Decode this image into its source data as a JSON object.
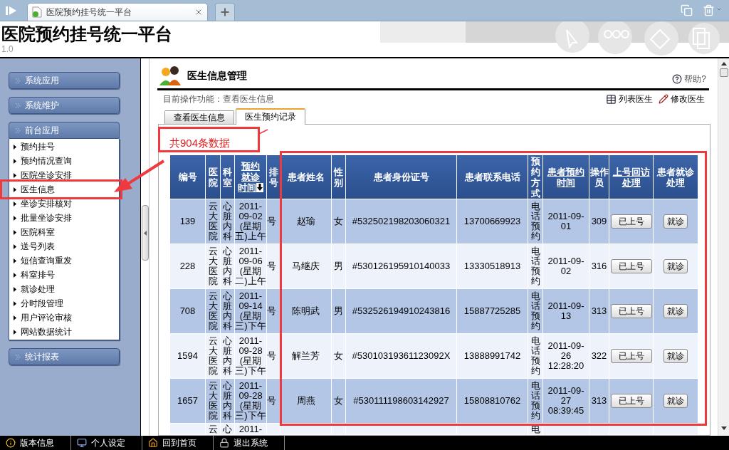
{
  "browser_tab": {
    "title": "医院预约挂号统一平台"
  },
  "header": {
    "title": "医院预约挂号统一平台",
    "version": "1.0"
  },
  "sidebar": {
    "groups": [
      {
        "label": "系统应用",
        "expanded": false
      },
      {
        "label": "系统维护",
        "expanded": false
      },
      {
        "label": "前台应用",
        "expanded": true,
        "items": [
          "预约挂号",
          "预约情况查询",
          "医院坐诊安排",
          "医生信息",
          "坐诊安排核对",
          "批量坐诊安排",
          "医院科室",
          "送号列表",
          "短信查询重发",
          "科室排号",
          "就诊处理",
          "分时段管理",
          "用户评论审核",
          "网站数据统计"
        ]
      },
      {
        "label": "统计报表",
        "expanded": false
      }
    ]
  },
  "panel": {
    "title": "医生信息管理",
    "help": "帮助?",
    "breadcrumb": "目前操作功能：查看医生信息",
    "actions": [
      {
        "label": "列表医生",
        "kind": "list"
      },
      {
        "label": "修改医生",
        "kind": "edit"
      }
    ]
  },
  "tabs": [
    {
      "label": "查看医生信息",
      "selected": false
    },
    {
      "label": "医生预约记录",
      "selected": true
    }
  ],
  "record_count": "共904条数据",
  "table": {
    "columns": [
      {
        "label": "编号",
        "link": false,
        "sorted": false
      },
      {
        "label": "医院",
        "link": false,
        "sorted": false
      },
      {
        "label": "科室",
        "link": false,
        "sorted": false
      },
      {
        "label": "预约就诊时间",
        "link": true,
        "sorted": true
      },
      {
        "label": "排号",
        "link": false,
        "sorted": false
      },
      {
        "label": "患者姓名",
        "link": false,
        "sorted": false
      },
      {
        "label": "性别",
        "link": false,
        "sorted": false
      },
      {
        "label": "患者身份证号",
        "link": false,
        "sorted": false
      },
      {
        "label": "患者联系电话",
        "link": false,
        "sorted": false
      },
      {
        "label": "预约方式",
        "link": false,
        "sorted": false
      },
      {
        "label": "患者预约时间",
        "link": true,
        "sorted": false
      },
      {
        "label": "操作员",
        "link": false,
        "sorted": false
      },
      {
        "label": "上号回访处理",
        "link": true,
        "sorted": false
      },
      {
        "label": "患者就诊处理",
        "link": false,
        "sorted": false
      }
    ],
    "rows": [
      {
        "id": "139",
        "hospital": "云大医院",
        "department": "心脏内科",
        "visit_time": "2011-\n09-02\n(星期五)上午",
        "slot": "号",
        "name": "赵瑜",
        "gender": "女",
        "id_card": "#532502198203060321",
        "phone": "13700669923",
        "method": "电话预约",
        "booked_at": "2011-09-\n01",
        "operator": "309",
        "callback_button": "已上号",
        "visit_button": "就诊"
      },
      {
        "id": "228",
        "hospital": "云大医院",
        "department": "心脏内科",
        "visit_time": "2011-\n09-06\n(星期二)上午",
        "slot": "号",
        "name": "马继庆",
        "gender": "男",
        "id_card": "#530126195910140033",
        "phone": "13330518913",
        "method": "电话预约",
        "booked_at": "2011-09-\n02",
        "operator": "316",
        "callback_button": "已上号",
        "visit_button": "就诊"
      },
      {
        "id": "708",
        "hospital": "云大医院",
        "department": "心脏内科",
        "visit_time": "2011-\n09-14\n(星期三)下午",
        "slot": "号",
        "name": "陈明武",
        "gender": "男",
        "id_card": "#532526194910243816",
        "phone": "15887725285",
        "method": "电话预约",
        "booked_at": "2011-09-\n13",
        "operator": "313",
        "callback_button": "已上号",
        "visit_button": "就诊"
      },
      {
        "id": "1594",
        "hospital": "云大医院",
        "department": "心脏内科",
        "visit_time": "2011-\n09-28\n(星期三)下午",
        "slot": "号",
        "name": "解兰芳",
        "gender": "女",
        "id_card": "#53010319361123092X",
        "phone": "13888991742",
        "method": "电话预约",
        "booked_at": "2011-09-\n26\n12:28:20",
        "operator": "322",
        "callback_button": "已上号",
        "visit_button": "就诊"
      },
      {
        "id": "1657",
        "hospital": "云大医院",
        "department": "心脏内科",
        "visit_time": "2011-\n09-28\n(星期三)下午",
        "slot": "号",
        "name": "周燕",
        "gender": "女",
        "id_card": "#530111198603142927",
        "phone": "15808810762",
        "method": "电话预约",
        "booked_at": "2011-09-\n27\n08:39:45",
        "operator": "313",
        "callback_button": "已上号",
        "visit_button": "就诊"
      }
    ],
    "cut_row": {
      "hospital": "云",
      "department": "心",
      "visit_time": "2011-",
      "method": "电"
    }
  },
  "status_bar": [
    {
      "label": "版本信息",
      "kind": "info"
    },
    {
      "label": "个人设定",
      "kind": "settings"
    },
    {
      "label": "回到首页",
      "kind": "home"
    },
    {
      "label": "退出系统",
      "kind": "logout"
    }
  ]
}
